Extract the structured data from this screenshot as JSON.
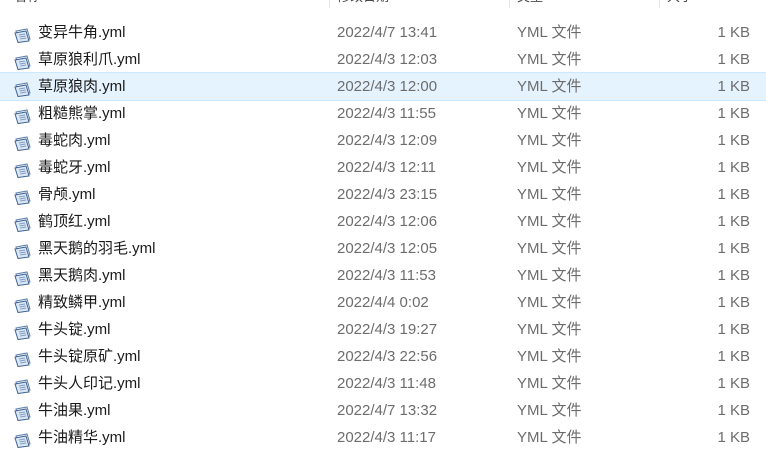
{
  "header": {
    "name_label": "名称",
    "date_label": "修改日期",
    "type_label": "类型",
    "size_label": "大小"
  },
  "files": [
    {
      "name": "变异牛角.yml",
      "date": "2022/4/7 13:41",
      "type": "YML 文件",
      "size": "1 KB",
      "icon": "yml-file-icon"
    },
    {
      "name": "草原狼利爪.yml",
      "date": "2022/4/3 12:03",
      "type": "YML 文件",
      "size": "1 KB",
      "icon": "yml-file-icon"
    },
    {
      "name": "草原狼肉.yml",
      "date": "2022/4/3 12:00",
      "type": "YML 文件",
      "size": "1 KB",
      "icon": "yml-file-icon",
      "selected": true
    },
    {
      "name": "粗糙熊掌.yml",
      "date": "2022/4/3 11:55",
      "type": "YML 文件",
      "size": "1 KB",
      "icon": "yml-file-icon"
    },
    {
      "name": "毒蛇肉.yml",
      "date": "2022/4/3 12:09",
      "type": "YML 文件",
      "size": "1 KB",
      "icon": "yml-file-icon"
    },
    {
      "name": "毒蛇牙.yml",
      "date": "2022/4/3 12:11",
      "type": "YML 文件",
      "size": "1 KB",
      "icon": "yml-file-icon"
    },
    {
      "name": "骨颅.yml",
      "date": "2022/4/3 23:15",
      "type": "YML 文件",
      "size": "1 KB",
      "icon": "yml-file-icon"
    },
    {
      "name": "鹤顶红.yml",
      "date": "2022/4/3 12:06",
      "type": "YML 文件",
      "size": "1 KB",
      "icon": "yml-file-icon"
    },
    {
      "name": "黑天鹅的羽毛.yml",
      "date": "2022/4/3 12:05",
      "type": "YML 文件",
      "size": "1 KB",
      "icon": "yml-file-icon"
    },
    {
      "name": "黑天鹅肉.yml",
      "date": "2022/4/3 11:53",
      "type": "YML 文件",
      "size": "1 KB",
      "icon": "yml-file-icon"
    },
    {
      "name": "精致鳞甲.yml",
      "date": "2022/4/4 0:02",
      "type": "YML 文件",
      "size": "1 KB",
      "icon": "yml-file-icon"
    },
    {
      "name": "牛头锭.yml",
      "date": "2022/4/3 19:27",
      "type": "YML 文件",
      "size": "1 KB",
      "icon": "yml-file-icon"
    },
    {
      "name": "牛头锭原矿.yml",
      "date": "2022/4/3 22:56",
      "type": "YML 文件",
      "size": "1 KB",
      "icon": "yml-file-icon"
    },
    {
      "name": "牛头人印记.yml",
      "date": "2022/4/3 11:48",
      "type": "YML 文件",
      "size": "1 KB",
      "icon": "yml-file-icon"
    },
    {
      "name": "牛油果.yml",
      "date": "2022/4/7 13:32",
      "type": "YML 文件",
      "size": "1 KB",
      "icon": "yml-file-icon"
    },
    {
      "name": "牛油精华.yml",
      "date": "2022/4/3 11:17",
      "type": "YML 文件",
      "size": "1 KB",
      "icon": "yml-file-icon"
    }
  ],
  "colors": {
    "selection_bg": "#e5f3ff",
    "selection_border": "#cce8ff",
    "secondary_text": "#6d6d6d"
  }
}
